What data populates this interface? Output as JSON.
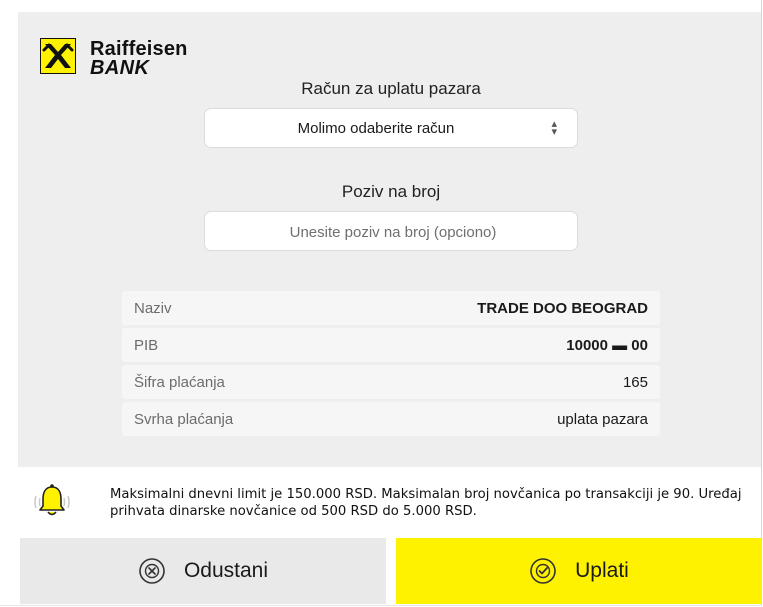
{
  "brand": {
    "name_line1": "Raiffeisen",
    "name_line2": "BANK"
  },
  "account_field": {
    "label": "Račun za uplatu pazara",
    "selected_value": "Molimo odaberite račun",
    "arrows": "⬍"
  },
  "reference_field": {
    "label": "Poziv na broj",
    "placeholder": "Unesite poziv na broj (opciono)",
    "value": ""
  },
  "details": [
    {
      "key": "Naziv",
      "value": "TRADE DOO BEOGRAD"
    },
    {
      "key": "PIB",
      "value": "10000 ▬ 00"
    },
    {
      "key": "Šifra plaćanja",
      "value": "165"
    },
    {
      "key": "Svrha plaćanja",
      "value": "uplata pazara"
    }
  ],
  "notice": {
    "icon": "bell-icon",
    "text": "Maksimalni dnevni limit je 150.000 RSD. Maksimalan broj novčanica po transakciji je 90. Uređaj prihvata dinarske novčanice od 500 RSD do 5.000 RSD."
  },
  "buttons": {
    "cancel_label": "Odustani",
    "pay_label": "Uplati"
  },
  "colors": {
    "brand_yellow": "#fff200",
    "panel_gray": "#eeeeee",
    "cancel_gray": "#e9e9e9"
  }
}
